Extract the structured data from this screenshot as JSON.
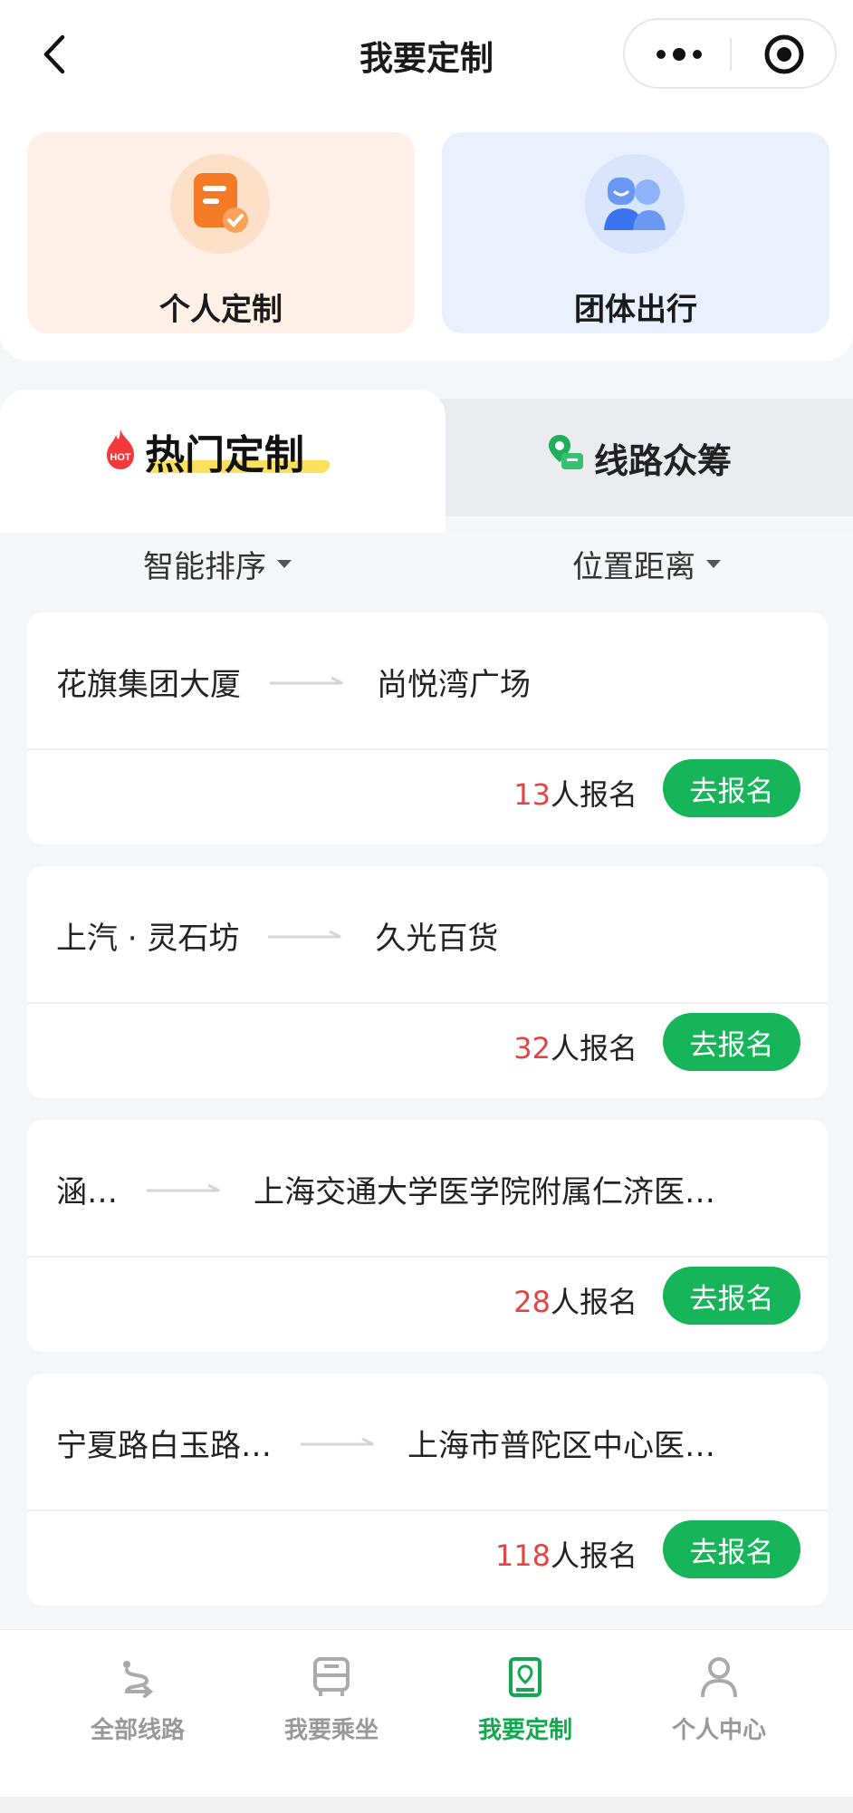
{
  "header": {
    "title": "我要定制"
  },
  "type_cards": [
    {
      "label": "个人定制",
      "icon": "document-icon"
    },
    {
      "label": "团体出行",
      "icon": "group-icon"
    }
  ],
  "tabs": {
    "active": "热门定制",
    "inactive": "线路众筹",
    "hot_badge": "HOT"
  },
  "sort": {
    "smart_sort": "智能排序",
    "distance": "位置距离"
  },
  "routes": [
    {
      "from": "花旗集团大厦",
      "to": "尚悦湾广场",
      "count": "13",
      "count_suffix": "人报名",
      "button": "去报名"
    },
    {
      "from": "上汽 · 灵石坊",
      "to": "久光百货",
      "count": "32",
      "count_suffix": "人报名",
      "button": "去报名"
    },
    {
      "from": "涵…",
      "to": "上海交通大学医学院附属仁济医…",
      "count": "28",
      "count_suffix": "人报名",
      "button": "去报名"
    },
    {
      "from": "宁夏路白玉路…",
      "to": "上海市普陀区中心医…",
      "count": "118",
      "count_suffix": "人报名",
      "button": "去报名"
    }
  ],
  "bottom_nav": [
    {
      "label": "全部线路",
      "icon": "route-icon",
      "active": false
    },
    {
      "label": "我要乘坐",
      "icon": "bus-icon",
      "active": false
    },
    {
      "label": "我要定制",
      "icon": "customize-icon",
      "active": true
    },
    {
      "label": "个人中心",
      "icon": "person-icon",
      "active": false
    }
  ],
  "colors": {
    "accent_green": "#16b55a",
    "count_red": "#e04646",
    "highlight_yellow": "#ffe05a"
  }
}
